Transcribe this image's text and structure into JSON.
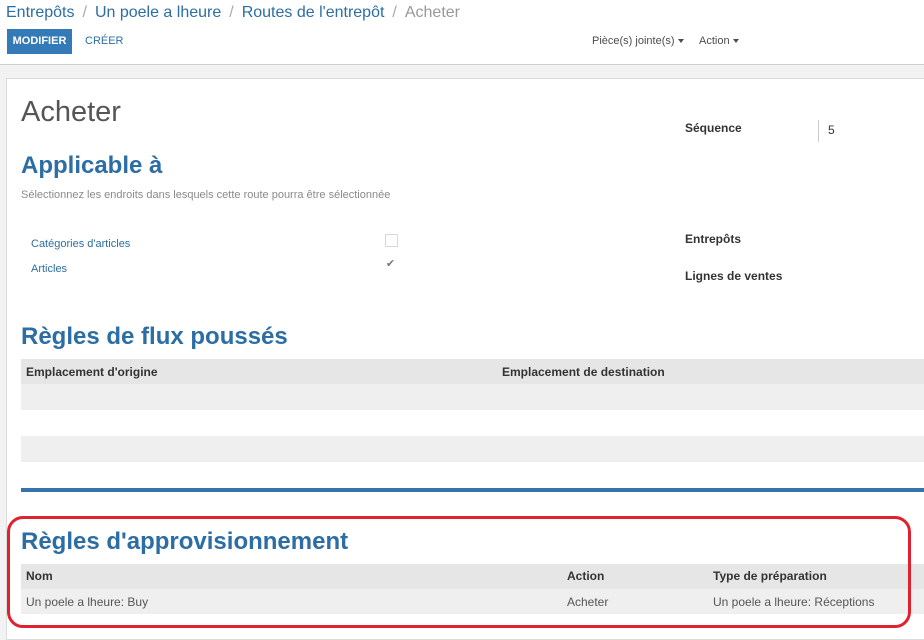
{
  "breadcrumb": {
    "items": [
      "Entrepôts",
      "Un poele a lheure",
      "Routes de l'entrepôt"
    ],
    "current": "Acheter",
    "separator": "/"
  },
  "toolbar": {
    "edit_label": "MODIFIER",
    "create_label": "CRÉER",
    "attachments_label": "Pièce(s) jointe(s)",
    "action_label": "Action"
  },
  "form": {
    "title": "Acheter",
    "sequence_label": "Séquence",
    "sequence_value": "5",
    "applicable_heading": "Applicable à",
    "applicable_help": "Sélectionnez les endroits dans lesquels cette route pourra être sélectionnée",
    "product_categories_label": "Catégories d'articles",
    "product_categories_checked": false,
    "products_label": "Articles",
    "products_checked": true,
    "warehouses_label": "Entrepôts",
    "sale_lines_label": "Lignes de ventes",
    "check_glyph": "✔"
  },
  "push_rules": {
    "heading": "Règles de flux poussés",
    "columns": [
      "Emplacement d'origine",
      "Emplacement de destination"
    ],
    "rows": []
  },
  "procurement_rules": {
    "heading": "Règles d'approvisionnement",
    "columns": [
      "Nom",
      "Action",
      "Type de préparation"
    ],
    "rows": [
      [
        "Un poele a lheure: Buy",
        "Acheter",
        "Un poele a lheure: Réceptions"
      ]
    ]
  },
  "colors": {
    "primary": "#337ab7",
    "heading_blue": "#2c6ea3",
    "highlight_red": "#e02130"
  }
}
